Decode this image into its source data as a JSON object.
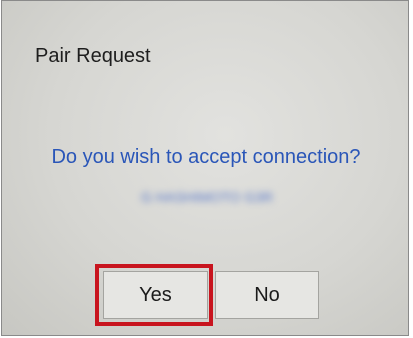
{
  "dialog": {
    "title": "Pair Request",
    "question": "Do you wish to accept connection?",
    "device_name": "G HASHIMOTO G3R"
  },
  "buttons": {
    "yes_label": "Yes",
    "no_label": "No"
  },
  "colors": {
    "question_text": "#2a56b8",
    "highlight": "#c8141e"
  }
}
